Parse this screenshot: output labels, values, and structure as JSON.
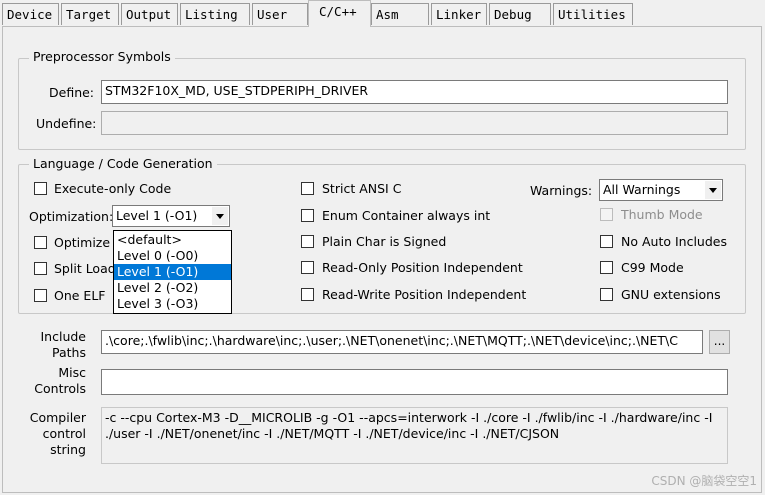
{
  "tabs": [
    {
      "label": "Device"
    },
    {
      "label": "Target"
    },
    {
      "label": "Output"
    },
    {
      "label": "Listing"
    },
    {
      "label": "User"
    },
    {
      "label": "C/C++"
    },
    {
      "label": "Asm"
    },
    {
      "label": "Linker"
    },
    {
      "label": "Debug"
    },
    {
      "label": "Utilities"
    }
  ],
  "active_tab": "C/C++",
  "preprocessor": {
    "legend": "Preprocessor Symbols",
    "define_label": "Define:",
    "define_value": "STM32F10X_MD, USE_STDPERIPH_DRIVER",
    "undefine_label": "Undefine:",
    "undefine_value": ""
  },
  "language": {
    "legend": "Language / Code Generation",
    "execute_only": {
      "label": "Execute-only Code",
      "checked": false
    },
    "optimization_label": "Optimization:",
    "optimization_value": "Level 1 (-O1)",
    "optimization_options": [
      "<default>",
      "Level 0 (-O0)",
      "Level 1 (-O1)",
      "Level 2 (-O2)",
      "Level 3 (-O3)"
    ],
    "optimization_selected_index": 2,
    "optimize_for_time": {
      "label": "Optimize f",
      "checked": false
    },
    "split_load": {
      "label": "Split Load",
      "checked": false
    },
    "one_elf": {
      "label": "One ELF",
      "checked": false
    },
    "strict_ansi": {
      "label": "Strict ANSI C",
      "checked": false
    },
    "enum_container": {
      "label": "Enum Container always int",
      "checked": false
    },
    "plain_char": {
      "label": "Plain Char is Signed",
      "checked": false
    },
    "ro_pos_indep": {
      "label": "Read-Only Position Independent",
      "checked": false
    },
    "rw_pos_indep": {
      "label": "Read-Write Position Independent",
      "checked": false
    },
    "warnings_label": "Warnings:",
    "warnings_value": "All Warnings",
    "thumb_mode": {
      "label": "Thumb Mode",
      "checked": false,
      "disabled": true
    },
    "no_auto_includes": {
      "label": "No Auto Includes",
      "checked": false
    },
    "c99_mode": {
      "label": "C99 Mode",
      "checked": false
    },
    "gnu_extensions": {
      "label": "GNU extensions",
      "checked": false
    }
  },
  "include_paths": {
    "label_line1": "Include",
    "label_line2": "Paths",
    "value": ".\\core;.\\fwlib\\inc;.\\hardware\\inc;.\\user;.\\NET\\onenet\\inc;.\\NET\\MQTT;.\\NET\\device\\inc;.\\NET\\C",
    "browse_label": "..."
  },
  "misc_controls": {
    "label_line1": "Misc",
    "label_line2": "Controls",
    "value": ""
  },
  "compiler_control": {
    "label_lines": [
      "Compiler",
      "control",
      "string"
    ],
    "value": "-c --cpu Cortex-M3 -D__MICROLIB -g -O1 --apcs=interwork -I ./core -I ./fwlib/inc -I ./hardware/inc -I ./user -I ./NET/onenet/inc -I ./NET/MQTT -I ./NET/device/inc -I ./NET/CJSON"
  },
  "watermark": "CSDN @脑袋空空1"
}
